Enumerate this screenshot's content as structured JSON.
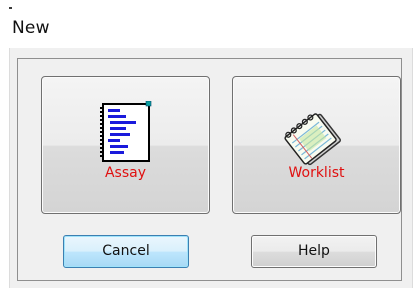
{
  "window": {
    "title": "New"
  },
  "choices": {
    "assay": {
      "label": "Assay",
      "icon": "assay-document-icon"
    },
    "worklist": {
      "label": "Worklist",
      "icon": "worklist-notepad-icon"
    }
  },
  "buttons": {
    "cancel_label": "Cancel",
    "help_label": "Help"
  },
  "colors": {
    "choice_label": "#e01010",
    "default_button_border": "#3c7fb1"
  }
}
